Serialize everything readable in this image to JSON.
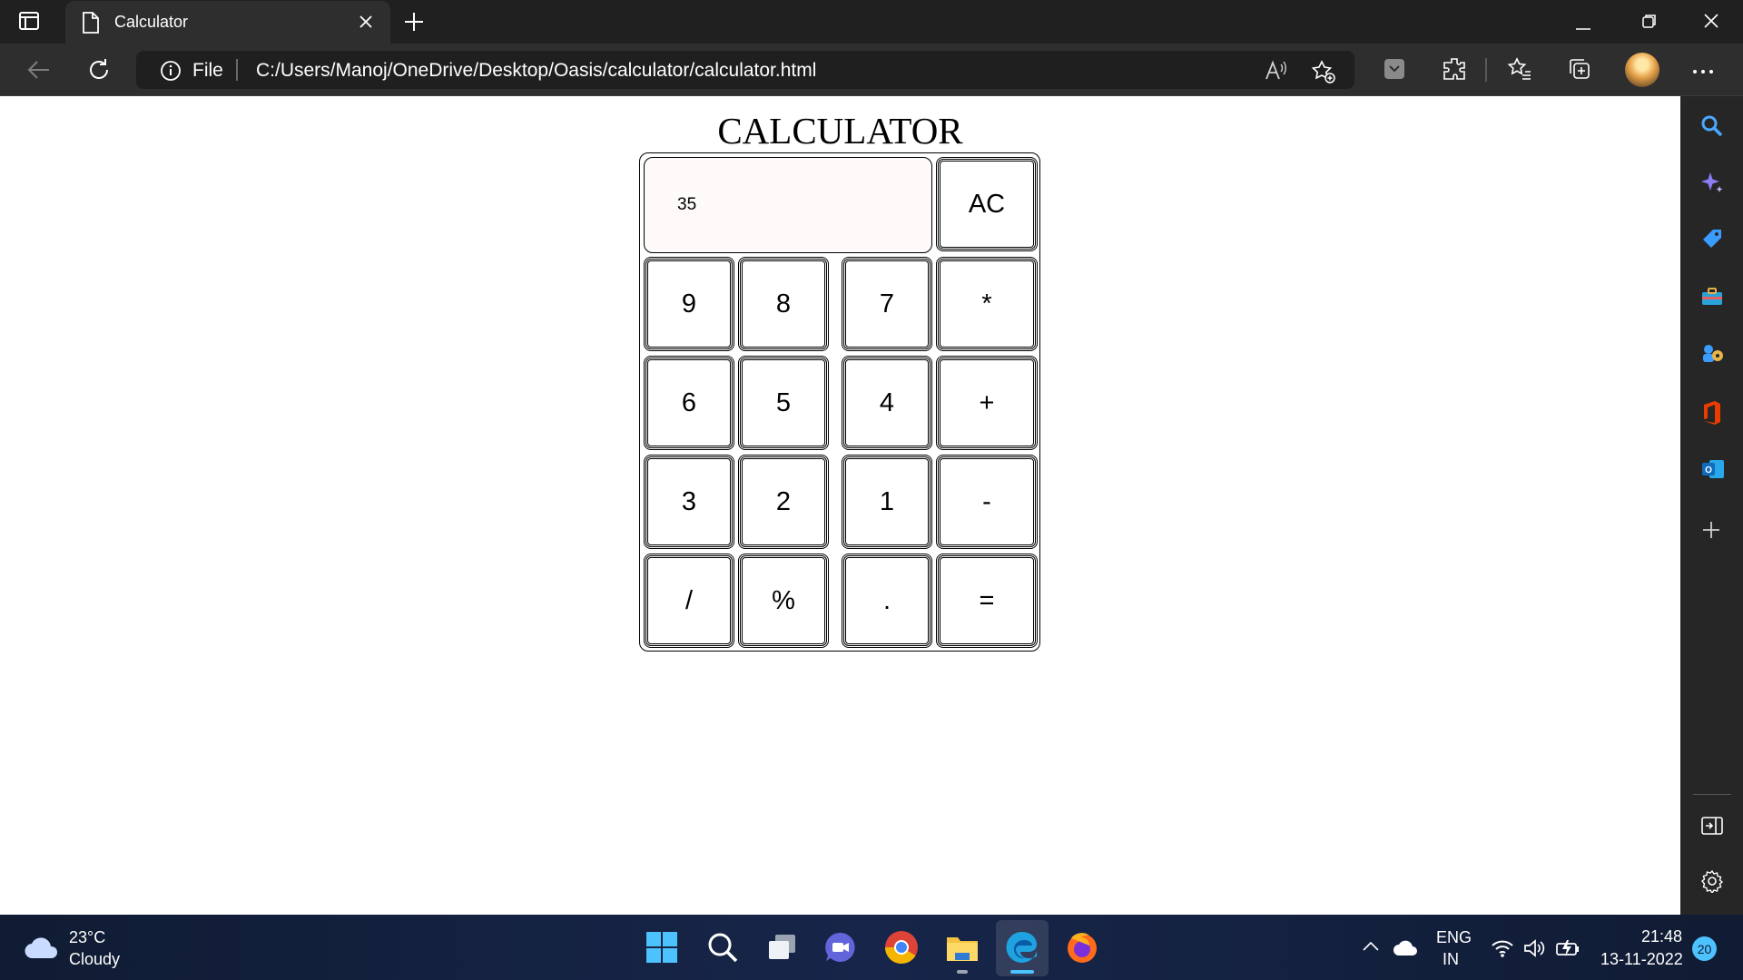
{
  "browser": {
    "tab_title": "Calculator",
    "address_scheme": "File",
    "address_url": "C:/Users/Manoj/OneDrive/Desktop/Oasis/calculator/calculator.html"
  },
  "page": {
    "title": "CALCULATOR",
    "display_value": "35",
    "keys": {
      "clear": "AC",
      "nine": "9",
      "eight": "8",
      "seven": "7",
      "multiply": "*",
      "six": "6",
      "five": "5",
      "four": "4",
      "add": "+",
      "three": "3",
      "two": "2",
      "one": "1",
      "subtract": "-",
      "divide": "/",
      "percent": "%",
      "decimal": ".",
      "equals": "="
    }
  },
  "taskbar": {
    "temperature": "23°C",
    "condition": "Cloudy",
    "lang_top": "ENG",
    "lang_bottom": "IN",
    "time": "21:48",
    "date": "13-11-2022",
    "notifications": "20"
  },
  "colors": {
    "tab_bar": "#202020",
    "toolbar": "#2e2e2e",
    "display_bg": "#fffafa",
    "taskbar": "#17254a",
    "accent": "#4cc2ff"
  }
}
